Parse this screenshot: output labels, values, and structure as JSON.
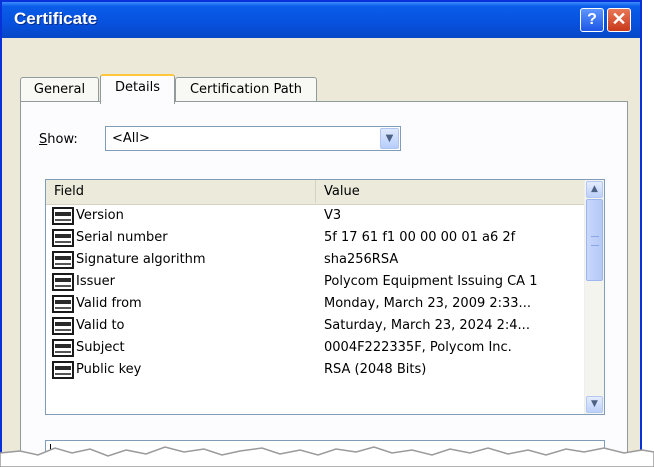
{
  "window": {
    "title": "Certificate",
    "help_label": "?",
    "close_label": "✕"
  },
  "tabs": [
    {
      "label": "General",
      "active": false
    },
    {
      "label": "Details",
      "active": true
    },
    {
      "label": "Certification Path",
      "active": false
    }
  ],
  "show": {
    "label_accel": "S",
    "label_rest": "how:",
    "value": "<All>"
  },
  "list": {
    "columns": [
      "Field",
      "Value"
    ],
    "rows": [
      {
        "field": "Version",
        "value": "V3"
      },
      {
        "field": "Serial number",
        "value": "5f 17 61 f1 00 00 00 01 a6 2f"
      },
      {
        "field": "Signature algorithm",
        "value": "sha256RSA"
      },
      {
        "field": "Issuer",
        "value": "Polycom Equipment Issuing CA 1"
      },
      {
        "field": "Valid from",
        "value": "Monday, March 23, 2009 2:33..."
      },
      {
        "field": "Valid to",
        "value": "Saturday, March 23, 2024 2:4..."
      },
      {
        "field": "Subject",
        "value": "0004F222335F, Polycom Inc."
      },
      {
        "field": "Public key",
        "value": "RSA (2048 Bits)"
      }
    ],
    "row_icon": "certificate-field-icon"
  },
  "icons": {
    "combo_arrow": "chevron-down-icon",
    "scroll_up": "chevron-up-icon",
    "scroll_down": "chevron-down-icon"
  },
  "colors": {
    "titlebar": "#0752e0",
    "dialog_bg": "#ece9d8",
    "active_tab_accent": "#ffc83c",
    "close_button": "#c8391b"
  }
}
